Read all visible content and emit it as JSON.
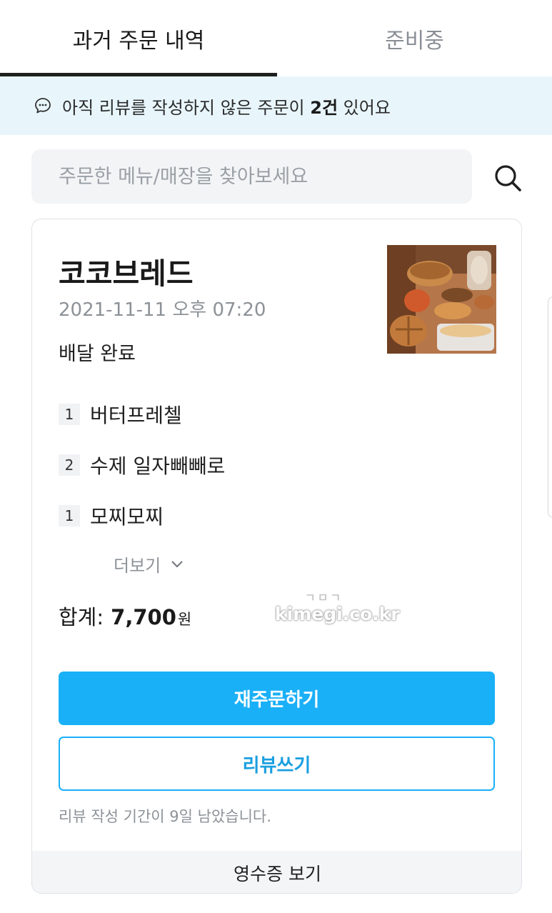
{
  "tabs": [
    {
      "label": "과거 주문 내역",
      "active": true
    },
    {
      "label": "준비중",
      "active": false
    }
  ],
  "notice": {
    "prefix": "아직 리뷰를 작성하지 않은 주문이 ",
    "count": "2건",
    "suffix": " 있어요"
  },
  "search": {
    "placeholder": "주문한 메뉴/매장을 찾아보세요",
    "value": ""
  },
  "order": {
    "store_name": "코코브레드",
    "date": "2021-11-11 오후 07:20",
    "status": "배달 완료",
    "items": [
      {
        "qty": "1",
        "name": "버터프레첼"
      },
      {
        "qty": "2",
        "name": "수제 일자빼빼로"
      },
      {
        "qty": "1",
        "name": "모찌모찌"
      }
    ],
    "more_label": "더보기",
    "total_label": "합계:",
    "total_amount": "7,700",
    "total_unit": "원",
    "reorder_label": "재주문하기",
    "review_label": "리뷰쓰기",
    "review_period": "리뷰 작성 기간이 9일 남았습니다.",
    "receipt_label": "영수증 보기"
  },
  "watermark": {
    "top": "ㄱㅁㄱ",
    "main": "kimegi.co.kr"
  },
  "colors": {
    "accent": "#1ab0f7",
    "notice_bg": "#e8f6fc",
    "muted_text": "#8d9298"
  },
  "icons": {
    "notice": "chat-bubble-icon",
    "search": "search-icon",
    "more": "chevron-down-icon"
  }
}
